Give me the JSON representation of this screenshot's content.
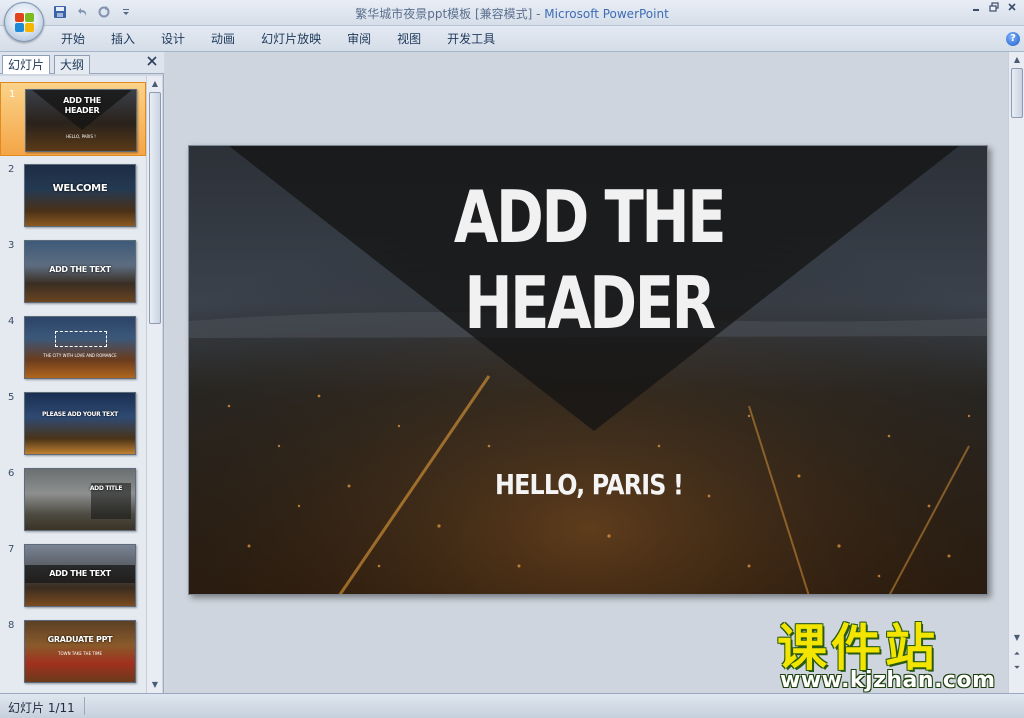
{
  "window": {
    "title": "繁华城市夜景ppt模板 [兼容模式]",
    "app_name": "Microsoft PowerPoint",
    "separator": " - "
  },
  "quick_access": [
    "save-icon",
    "undo-icon",
    "redo-icon",
    "customize-icon"
  ],
  "ribbon": {
    "tabs": [
      "开始",
      "插入",
      "设计",
      "动画",
      "幻灯片放映",
      "审阅",
      "视图",
      "开发工具"
    ]
  },
  "left_pane": {
    "tabs": [
      "幻灯片",
      "大纲"
    ],
    "thumbnails": [
      {
        "num": "1",
        "title": "ADD THE HEADER",
        "sub": "HELLO, PARIS !"
      },
      {
        "num": "2",
        "title": "WELCOME",
        "sub": ""
      },
      {
        "num": "3",
        "title": "ADD THE TEXT",
        "sub": ""
      },
      {
        "num": "4",
        "title": "",
        "sub": "THE CITY WITH LOVE AND ROMANCE"
      },
      {
        "num": "5",
        "title": "PLEASE ADD YOUR TEXT",
        "sub": ""
      },
      {
        "num": "6",
        "title": "ADD TITLE",
        "sub": ""
      },
      {
        "num": "7",
        "title": "ADD THE TEXT",
        "sub": ""
      },
      {
        "num": "8",
        "title": "GRADUATE PPT",
        "sub": "TOWN TAKE THE TIME"
      }
    ]
  },
  "slide": {
    "header_line1": "ADD THE",
    "header_line2": "HEADER",
    "subtitle": "HELLO, PARIS !"
  },
  "watermark": {
    "main": "课件站",
    "url": "www.kjzhan.com"
  },
  "status": {
    "slide_position": "幻灯片 1/11"
  },
  "colors": {
    "selection": "#f4a547",
    "watermark_yellow": "#f3e500",
    "accent_blue": "#3e6cb5"
  }
}
